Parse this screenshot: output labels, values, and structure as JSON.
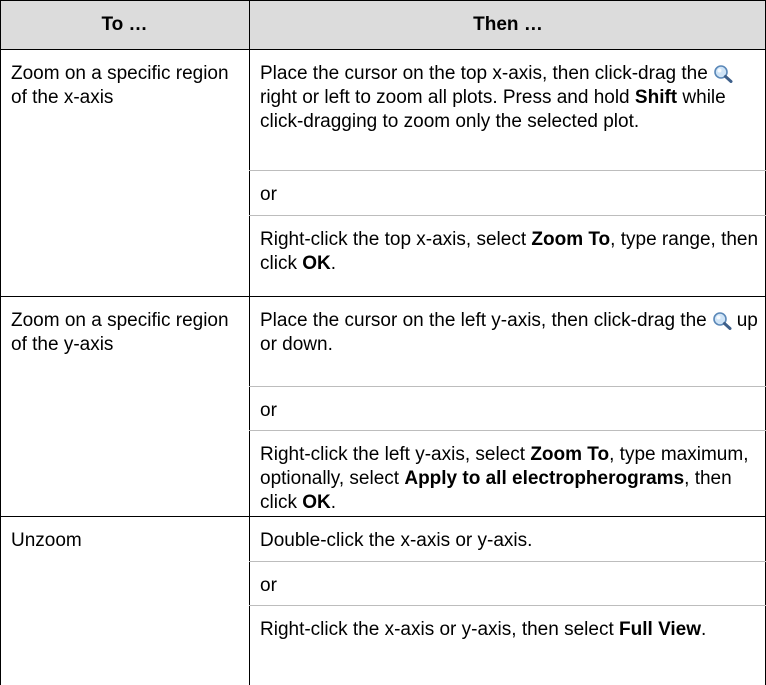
{
  "header": {
    "col_to": "To …",
    "col_then": "Then …"
  },
  "rows": [
    {
      "to": "Zoom on a specific region of the x-axis",
      "then1_pre": "Place the cursor on the top x-axis, then click-drag the",
      "then1_post": "right or left to zoom all plots. Press and hold",
      "then1_bold": "Shift",
      "then1_tail": "while click-dragging to zoom only the selected plot.",
      "or": "or",
      "then2_pre": "Right-click the top x-axis, select",
      "then2_bold1": "Zoom To",
      "then2_mid": ", type range, then click",
      "then2_bold2": "OK",
      "then2_end": "."
    },
    {
      "to": "Zoom on a specific region of the y-axis",
      "then1_pre": "Place the cursor on the left y-axis, then click-drag the",
      "then1_post": "up or down.",
      "or": "or",
      "then2_pre": "Right-click the left y-axis, select",
      "then2_bold1": "Zoom To",
      "then2_mid": ", type maximum, optionally, select",
      "then2_bold2": "Apply to all electropherograms",
      "then2_mid2": ", then click",
      "then2_bold3": "OK",
      "then2_end": "."
    },
    {
      "to": "Unzoom",
      "then1": "Double-click the x-axis or y-axis.",
      "or": "or",
      "then2_pre": "Right-click the x-axis or y-axis, then select",
      "then2_bold1": "Full View",
      "then2_end": "."
    }
  ],
  "icons": {
    "magnifier": "magnifier-icon"
  }
}
